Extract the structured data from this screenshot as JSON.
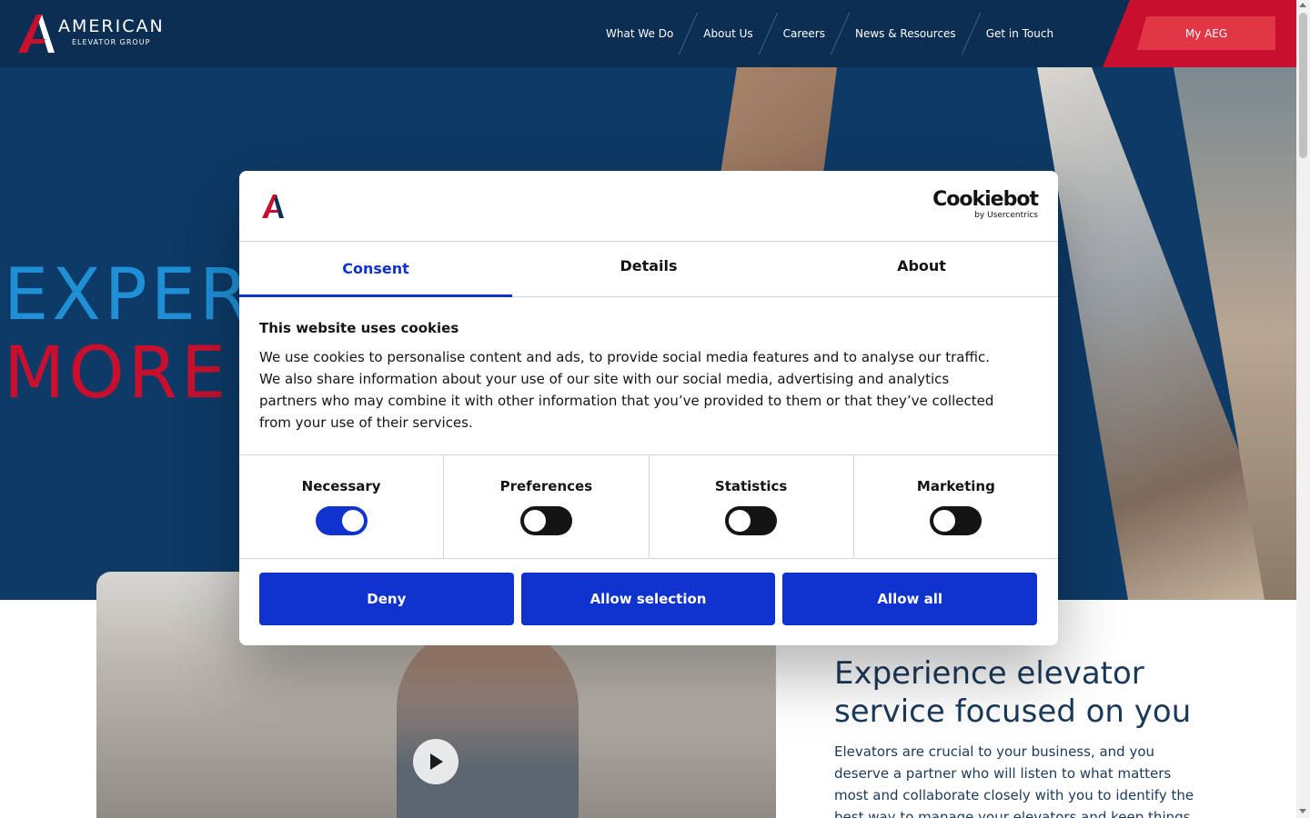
{
  "header": {
    "logo": {
      "word": "AMERICAN",
      "sub": "ELEVATOR GROUP"
    },
    "nav": [
      "What We Do",
      "About Us",
      "Careers",
      "News & Resources",
      "Get in Touch"
    ],
    "cta": "My AEG"
  },
  "hero": {
    "line1": "EXPER",
    "line2": "MORE"
  },
  "promo": {
    "title": "Experience elevator service focused on you",
    "text": "Elevators are crucial to your business, and you deserve a partner who will listen to what matters most and collaborate closely with you to identify the best way to manage your elevators and keep things operating"
  },
  "cookie_dialog": {
    "brand_name": "Cookiebot",
    "brand_by": "by Usercentrics",
    "tabs": [
      "Consent",
      "Details",
      "About"
    ],
    "active_tab": "Consent",
    "title": "This website uses cookies",
    "text": "We use cookies to personalise content and ads, to provide social media features and to analyse our traffic. We also share information about your use of our site with our social media, advertising and analytics partners who may combine it with other information that you’ve provided to them or that they’ve collected from your use of their services.",
    "toggles": [
      {
        "label": "Necessary",
        "on": true
      },
      {
        "label": "Preferences",
        "on": false
      },
      {
        "label": "Statistics",
        "on": false
      },
      {
        "label": "Marketing",
        "on": false
      }
    ],
    "buttons": {
      "deny": "Deny",
      "allow_selection": "Allow selection",
      "allow_all": "Allow all"
    }
  },
  "colors": {
    "navy": "#0b2e52",
    "brand_red": "#c8102e",
    "hero_blue": "#1f8fd6",
    "cookie_blue": "#1032cf"
  }
}
